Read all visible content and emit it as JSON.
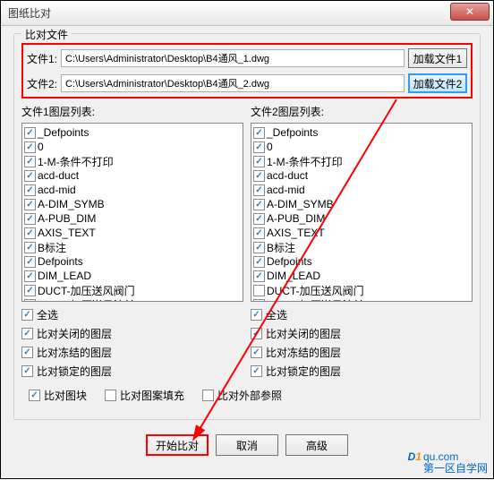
{
  "window": {
    "title": "图纸比对"
  },
  "section": {
    "files_title": "比对文件"
  },
  "file1": {
    "label": "文件1:",
    "path": "C:\\Users\\Administrator\\Desktop\\B4通风_1.dwg",
    "button": "加载文件1"
  },
  "file2": {
    "label": "文件2:",
    "path": "C:\\Users\\Administrator\\Desktop\\B4通风_2.dwg",
    "button": "加载文件2"
  },
  "list1": {
    "label": "文件1图层列表:"
  },
  "list2": {
    "label": "文件2图层列表:"
  },
  "layers1": [
    "_Defpoints",
    "0",
    "1-M-条件不打印",
    "acd-duct",
    "acd-mid",
    "A-DIM_SYMB",
    "A-PUB_DIM",
    "AXIS_TEXT",
    "B标注",
    "Defpoints",
    "DIM_LEAD",
    "DUCT-加压送风阀门",
    "DUCT-加压送风法兰"
  ],
  "layers2": [
    "_Defpoints",
    "0",
    "1-M-条件不打印",
    "acd-duct",
    "acd-mid",
    "A-DIM_SYMB",
    "A-PUB_DIM",
    "AXIS_TEXT",
    "B标注",
    "Defpoints",
    "DIM_LEAD",
    "DUCT-加压送风阀门",
    "DUCT-加压送风法兰"
  ],
  "layers2_unchecked_idx": 11,
  "opts": {
    "select_all": "全选",
    "closed": "比对关闭的图层",
    "frozen": "比对冻结的图层",
    "locked": "比对锁定的图层",
    "block": "比对图块",
    "hatch": "比对图案填充",
    "xref": "比对外部参照"
  },
  "buttons": {
    "start": "开始比对",
    "cancel": "取消",
    "advanced": "高级"
  },
  "watermark": {
    "logo_d": "D",
    "logo_1": "1",
    "domain": "qu.com",
    "sub": "第一区自学网"
  }
}
